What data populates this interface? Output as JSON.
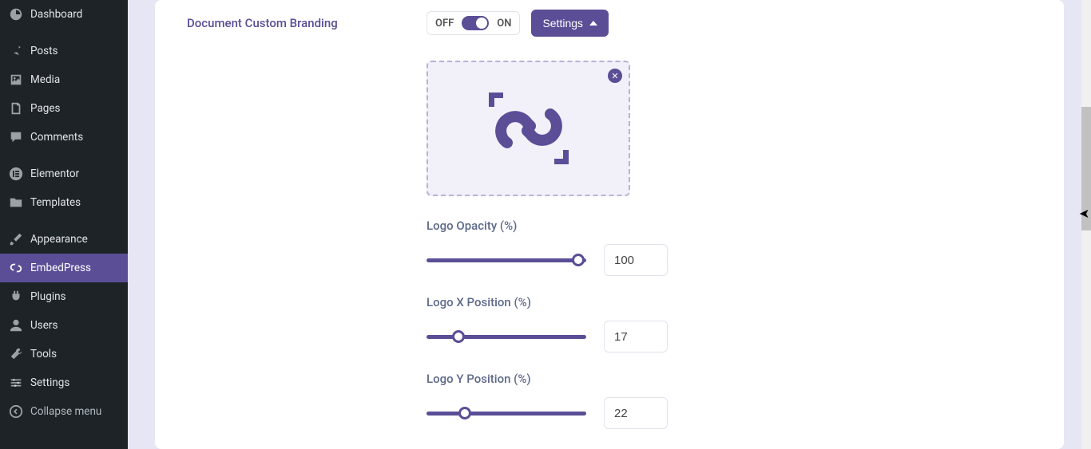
{
  "sidebar": {
    "items": [
      {
        "label": "Dashboard"
      },
      {
        "label": "Posts"
      },
      {
        "label": "Media"
      },
      {
        "label": "Pages"
      },
      {
        "label": "Comments"
      },
      {
        "label": "Elementor"
      },
      {
        "label": "Templates"
      },
      {
        "label": "Appearance"
      },
      {
        "label": "EmbedPress"
      },
      {
        "label": "Plugins"
      },
      {
        "label": "Users"
      },
      {
        "label": "Tools"
      },
      {
        "label": "Settings"
      },
      {
        "label": "Collapse menu"
      }
    ]
  },
  "section": {
    "title": "Document Custom Branding"
  },
  "toggle": {
    "off": "OFF",
    "on": "ON"
  },
  "settings_btn": "Settings",
  "fields": {
    "opacity": {
      "label": "Logo Opacity (%)",
      "value": "100",
      "pct": 95
    },
    "xpos": {
      "label": "Logo X Position (%)",
      "value": "17",
      "pct": 20
    },
    "ypos": {
      "label": "Logo Y Position (%)",
      "value": "22",
      "pct": 24
    }
  }
}
